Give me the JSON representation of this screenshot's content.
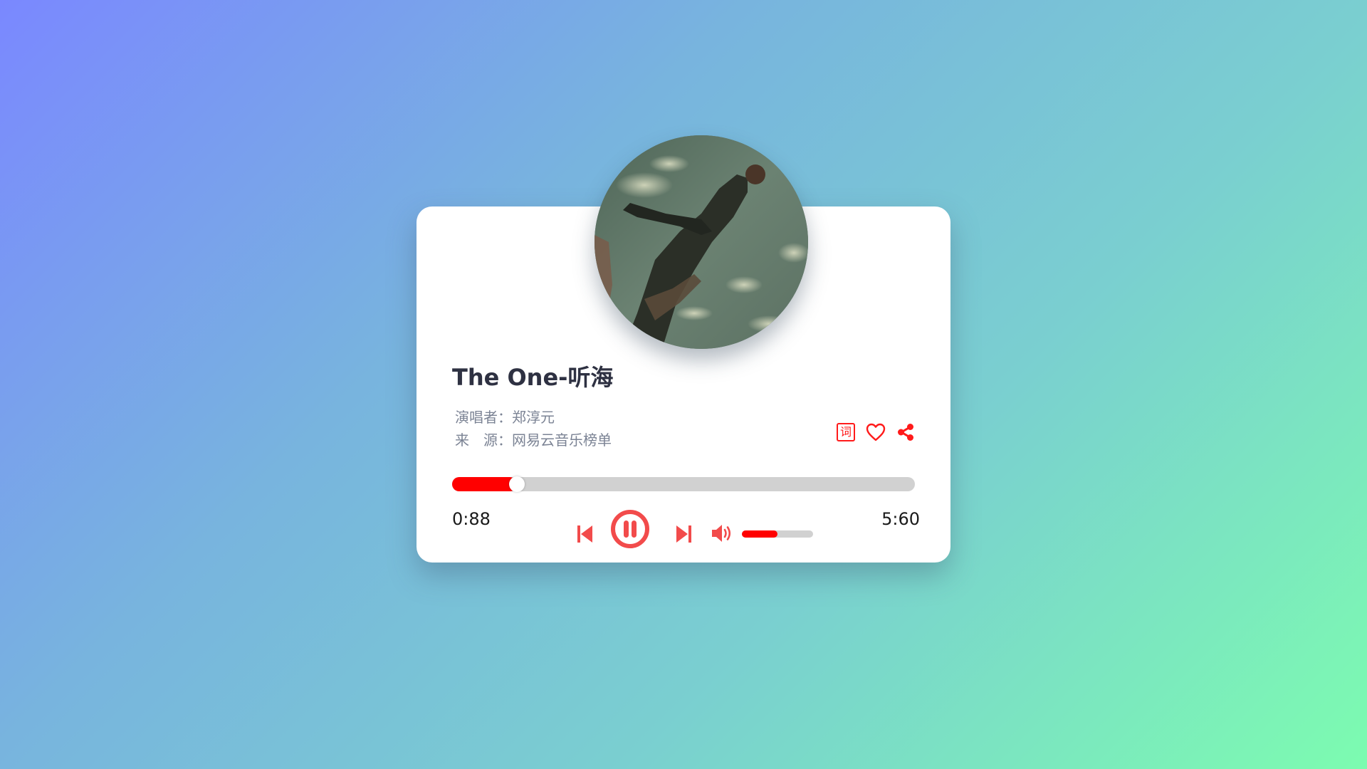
{
  "song": {
    "title": "The One-听海",
    "artist_line": "演唱者：郑淳元",
    "source_line": "来　源：网易云音乐榜单"
  },
  "actions": {
    "lyrics_label": "词",
    "lyrics_icon": "lyrics-icon",
    "favorite_icon": "heart-icon",
    "share_icon": "share-icon"
  },
  "playback": {
    "current_time": "0:88",
    "total_time": "5:60",
    "progress_fraction": 0.14,
    "state": "playing"
  },
  "controls": {
    "prev_icon": "skip-previous-icon",
    "pause_icon": "pause-icon",
    "next_icon": "skip-next-icon",
    "volume_icon": "volume-icon"
  },
  "volume": {
    "level_fraction": 0.5
  },
  "colors": {
    "accent": "#ff0000",
    "control": "#f24b4b",
    "track": "#d1d1d1",
    "title": "#2e3142",
    "meta": "#7b8394"
  }
}
